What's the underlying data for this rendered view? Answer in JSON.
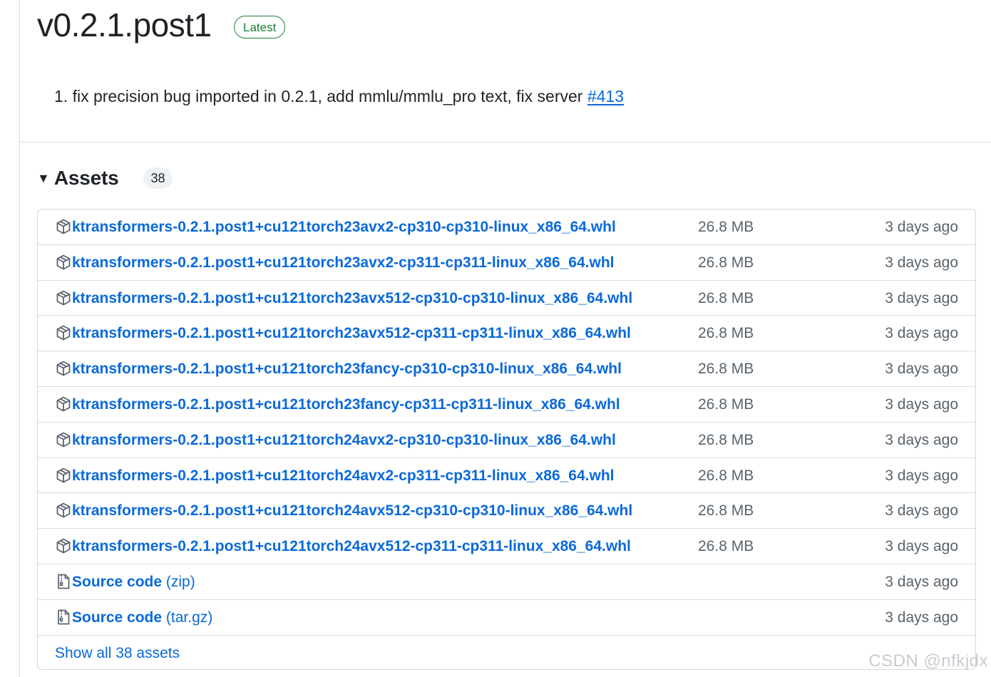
{
  "release": {
    "title": "v0.2.1.post1",
    "badge": "Latest",
    "notes_text": "1. fix precision bug imported in 0.2.1, add mmlu/mmlu_pro text, fix server ",
    "notes_link": "#413"
  },
  "assets": {
    "title": "Assets",
    "count": "38",
    "items": [
      {
        "name": "ktransformers-0.2.1.post1+cu121torch23avx2-cp310-cp310-linux_x86_64.whl",
        "size": "26.8 MB",
        "date": "3 days ago",
        "icon": "package-icon"
      },
      {
        "name": "ktransformers-0.2.1.post1+cu121torch23avx2-cp311-cp311-linux_x86_64.whl",
        "size": "26.8 MB",
        "date": "3 days ago",
        "icon": "package-icon"
      },
      {
        "name": "ktransformers-0.2.1.post1+cu121torch23avx512-cp310-cp310-linux_x86_64.whl",
        "size": "26.8 MB",
        "date": "3 days ago",
        "icon": "package-icon"
      },
      {
        "name": "ktransformers-0.2.1.post1+cu121torch23avx512-cp311-cp311-linux_x86_64.whl",
        "size": "26.8 MB",
        "date": "3 days ago",
        "icon": "package-icon"
      },
      {
        "name": "ktransformers-0.2.1.post1+cu121torch23fancy-cp310-cp310-linux_x86_64.whl",
        "size": "26.8 MB",
        "date": "3 days ago",
        "icon": "package-icon"
      },
      {
        "name": "ktransformers-0.2.1.post1+cu121torch23fancy-cp311-cp311-linux_x86_64.whl",
        "size": "26.8 MB",
        "date": "3 days ago",
        "icon": "package-icon"
      },
      {
        "name": "ktransformers-0.2.1.post1+cu121torch24avx2-cp310-cp310-linux_x86_64.whl",
        "size": "26.8 MB",
        "date": "3 days ago",
        "icon": "package-icon"
      },
      {
        "name": "ktransformers-0.2.1.post1+cu121torch24avx2-cp311-cp311-linux_x86_64.whl",
        "size": "26.8 MB",
        "date": "3 days ago",
        "icon": "package-icon"
      },
      {
        "name": "ktransformers-0.2.1.post1+cu121torch24avx512-cp310-cp310-linux_x86_64.whl",
        "size": "26.8 MB",
        "date": "3 days ago",
        "icon": "package-icon"
      },
      {
        "name": "ktransformers-0.2.1.post1+cu121torch24avx512-cp311-cp311-linux_x86_64.whl",
        "size": "26.8 MB",
        "date": "3 days ago",
        "icon": "package-icon"
      }
    ],
    "source_items": [
      {
        "name": "Source code",
        "suffix": "(zip)",
        "date": "3 days ago",
        "icon": "file-zip-icon"
      },
      {
        "name": "Source code",
        "suffix": "(tar.gz)",
        "date": "3 days ago",
        "icon": "file-zip-icon"
      }
    ],
    "show_all": "Show all 38 assets"
  },
  "watermark": "CSDN @nfkjdx",
  "colors": {
    "link": "#0969da",
    "muted": "#59636e",
    "success": "#1a7f37",
    "border": "#d0d7de"
  }
}
